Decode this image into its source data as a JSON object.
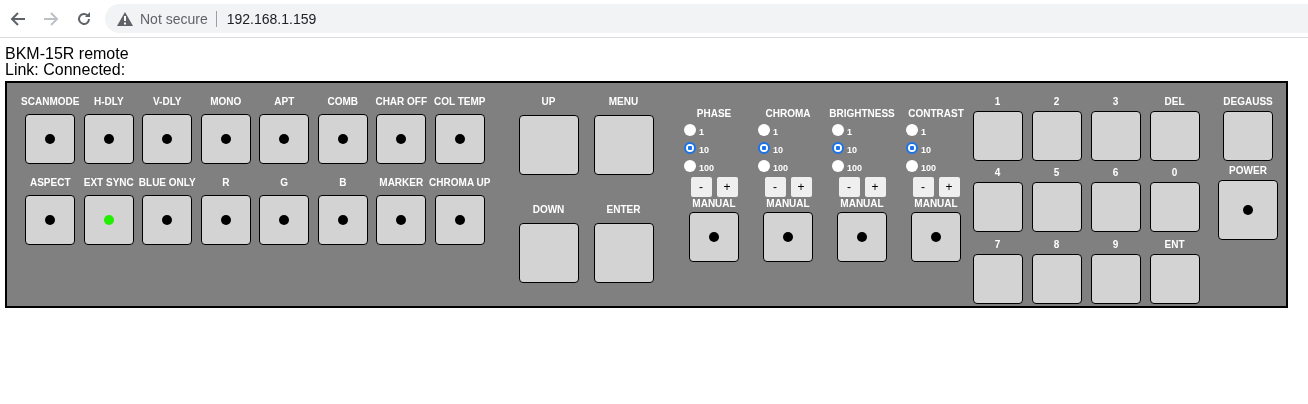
{
  "browser": {
    "security": "Not secure",
    "url": "192.168.1.159",
    "forward_enabled": false
  },
  "title": "BKM-15R remote",
  "link_status": "Link: Connected:",
  "function_rows": [
    [
      {
        "label": "SCANMODE",
        "lit": false
      },
      {
        "label": "H-DLY",
        "lit": false
      },
      {
        "label": "V-DLY",
        "lit": false
      },
      {
        "label": "MONO",
        "lit": false
      },
      {
        "label": "APT",
        "lit": false
      },
      {
        "label": "COMB",
        "lit": false
      },
      {
        "label": "CHAR OFF",
        "lit": false
      },
      {
        "label": "COL TEMP",
        "lit": false
      }
    ],
    [
      {
        "label": "ASPECT",
        "lit": false
      },
      {
        "label": "EXT SYNC",
        "lit": true
      },
      {
        "label": "BLUE ONLY",
        "lit": false
      },
      {
        "label": "R",
        "lit": false
      },
      {
        "label": "G",
        "lit": false
      },
      {
        "label": "B",
        "lit": false
      },
      {
        "label": "MARKER",
        "lit": false
      },
      {
        "label": "CHROMA UP",
        "lit": false
      }
    ]
  ],
  "nav_buttons": [
    {
      "label": "UP"
    },
    {
      "label": "MENU"
    },
    {
      "label": "DOWN"
    },
    {
      "label": "ENTER"
    }
  ],
  "adjusters": [
    {
      "name": "PHASE",
      "steps": [
        {
          "label": "1",
          "selected": false
        },
        {
          "label": "10",
          "selected": true
        },
        {
          "label": "100",
          "selected": false
        }
      ],
      "minus": "-",
      "plus": "+",
      "manual": "MANUAL",
      "lit": false
    },
    {
      "name": "CHROMA",
      "steps": [
        {
          "label": "1",
          "selected": false
        },
        {
          "label": "10",
          "selected": true
        },
        {
          "label": "100",
          "selected": false
        }
      ],
      "minus": "-",
      "plus": "+",
      "manual": "MANUAL",
      "lit": false
    },
    {
      "name": "BRIGHTNESS",
      "steps": [
        {
          "label": "1",
          "selected": false
        },
        {
          "label": "10",
          "selected": true
        },
        {
          "label": "100",
          "selected": false
        }
      ],
      "minus": "-",
      "plus": "+",
      "manual": "MANUAL",
      "lit": false
    },
    {
      "name": "CONTRAST",
      "steps": [
        {
          "label": "1",
          "selected": false
        },
        {
          "label": "10",
          "selected": true
        },
        {
          "label": "100",
          "selected": false
        }
      ],
      "minus": "-",
      "plus": "+",
      "manual": "MANUAL",
      "lit": false
    }
  ],
  "keypad": [
    {
      "label": "1"
    },
    {
      "label": "2"
    },
    {
      "label": "3"
    },
    {
      "label": "DEL"
    },
    {
      "label": "4"
    },
    {
      "label": "5"
    },
    {
      "label": "6"
    },
    {
      "label": "0"
    },
    {
      "label": "7"
    },
    {
      "label": "8"
    },
    {
      "label": "9"
    },
    {
      "label": "ENT"
    }
  ],
  "degauss": {
    "label": "DEGAUSS"
  },
  "power": {
    "label": "POWER",
    "lit": false
  }
}
